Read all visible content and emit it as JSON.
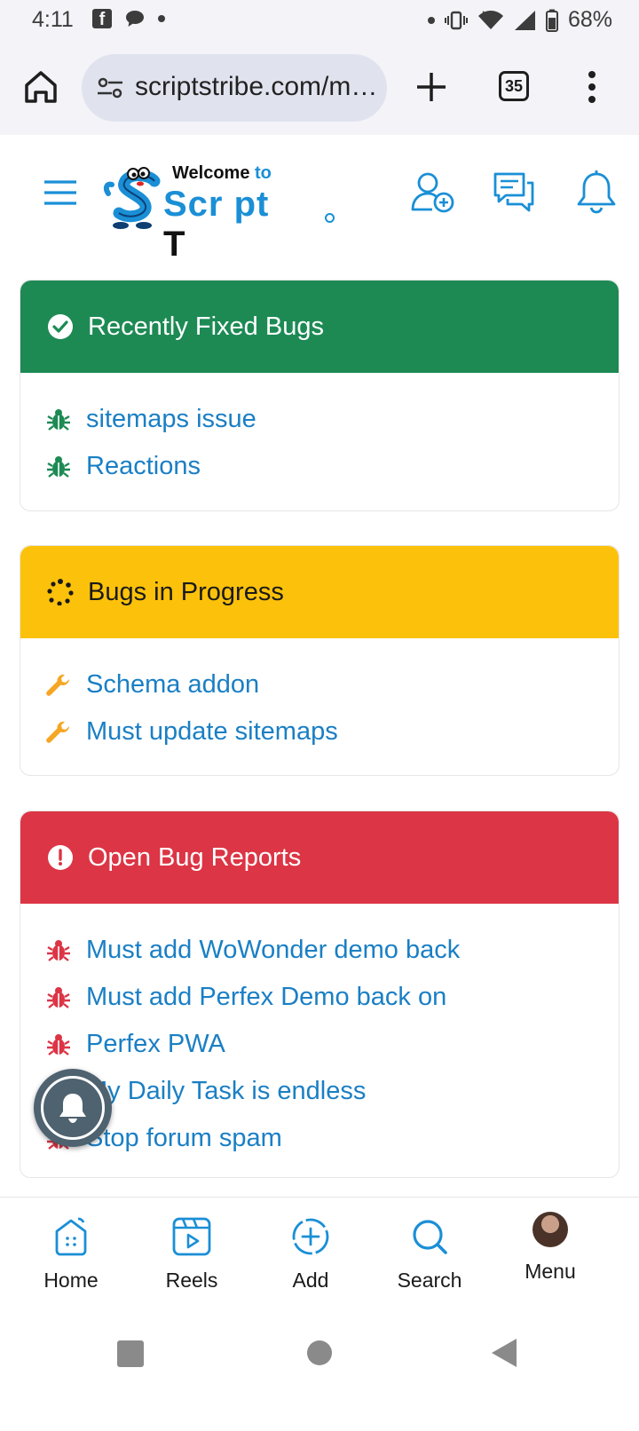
{
  "status_bar": {
    "time": "4:11",
    "battery": "68%",
    "icons": [
      "facebook-icon",
      "chat-bubble-icon",
      "dot-icon",
      "vibrate-icon",
      "wifi-icon",
      "signal-icon",
      "battery-icon"
    ]
  },
  "browser": {
    "url": "scriptstribe.com/m…",
    "tab_count": "35"
  },
  "site_header": {
    "logo_welcome": "Welcome",
    "logo_to": "to",
    "logo_script": "Scr pt",
    "logo_t": "T"
  },
  "cards": {
    "fixed": {
      "title": "Recently Fixed Bugs",
      "color": "#1d8a54",
      "items": [
        "sitemaps issue",
        "Reactions"
      ]
    },
    "progress": {
      "title": "Bugs in Progress",
      "color": "#fcc10a",
      "items": [
        "Schema addon",
        "Must update sitemaps"
      ]
    },
    "open": {
      "title": "Open Bug Reports",
      "color": "#dc3545",
      "items": [
        "Must add WoWonder demo back",
        "Must add Perfex Demo back on",
        "Perfex PWA",
        "My Daily Task is endless",
        "Stop forum spam"
      ]
    }
  },
  "bottom_nav": {
    "home": "Home",
    "reels": "Reels",
    "add": "Add",
    "search": "Search",
    "menu": "Menu"
  },
  "colors": {
    "link": "#1a7fc4",
    "accent": "#1a8fd6"
  }
}
